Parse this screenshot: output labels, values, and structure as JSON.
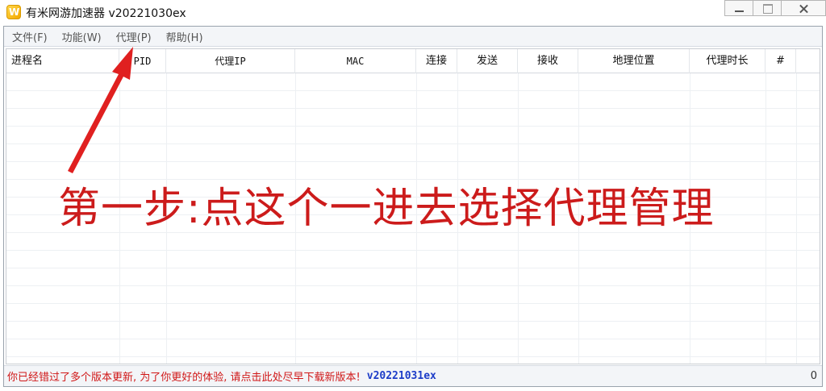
{
  "window": {
    "title": "有米网游加速器 v20221030ex",
    "icon": "app-logo-icon"
  },
  "menu": {
    "items": [
      "文件(F)",
      "功能(W)",
      "代理(P)",
      "帮助(H)"
    ]
  },
  "table": {
    "columns": [
      "进程名",
      "PID",
      "代理IP",
      "MAC",
      "连接",
      "发送",
      "接收",
      "地理位置",
      "代理时长",
      "#"
    ],
    "rows": []
  },
  "annotation": {
    "text": "第一步:点这个一进去选择代理管理",
    "color": "#cc1b1b"
  },
  "status": {
    "message": "你已经错过了多个版本更新, 为了你更好的体验, 请点击此处尽早下载新版本!",
    "version": "v20221031ex",
    "count": "0"
  }
}
